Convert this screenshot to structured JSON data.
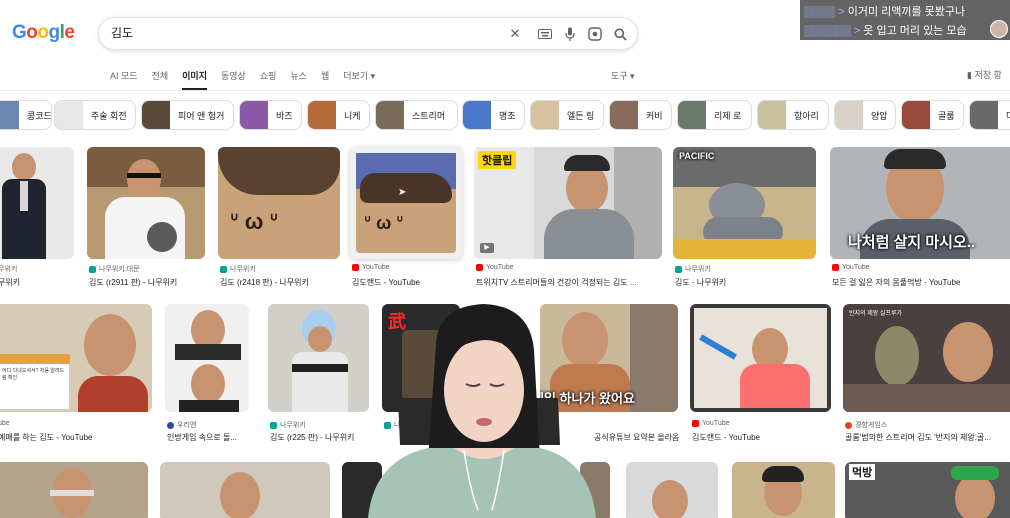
{
  "search": {
    "query": "김도"
  },
  "chat": [
    {
      "user": "",
      "message": "이거미 리액끼를 못봤구나"
    },
    {
      "user": "",
      "message": "옷 입고 머리 있는 모습"
    }
  ],
  "tabs": [
    {
      "label": "AI 모드"
    },
    {
      "label": "전체"
    },
    {
      "label": "이미지"
    },
    {
      "label": "동영상"
    },
    {
      "label": "쇼핑"
    },
    {
      "label": "뉴스"
    },
    {
      "label": "웹"
    },
    {
      "label": "더보기 ▾"
    }
  ],
  "tools_label": "도구 ▾",
  "saved_label": "저장 항",
  "chips": [
    {
      "label": "콩코드",
      "color": "#6b86b0"
    },
    {
      "label": "주술 회전",
      "color": "#e8e8e8"
    },
    {
      "label": "피어 앤 헝거",
      "color": "#5b4b3a"
    },
    {
      "label": "바즈",
      "color": "#8a5aa8"
    },
    {
      "label": "니케",
      "color": "#b66a3a"
    },
    {
      "label": "스트리머",
      "color": "#7a6a58"
    },
    {
      "label": "명조",
      "color": "#4a78c8"
    },
    {
      "label": "엘든 링",
      "color": "#d6c2a0"
    },
    {
      "label": "커비",
      "color": "#8a6a5a"
    },
    {
      "label": "리제 로",
      "color": "#6a7a6a"
    },
    {
      "label": "항아리",
      "color": "#c9c0a0"
    },
    {
      "label": "양압",
      "color": "#d9d2c8"
    },
    {
      "label": "골룸",
      "color": "#9a4a3a"
    },
    {
      "label": "더",
      "color": "#6a6a6a"
    }
  ],
  "results_row1": [
    {
      "source": "무위키",
      "caption": "무위키",
      "fav": "nw"
    },
    {
      "source": "나무위키:대문",
      "caption": "김도 (r2911 판) - 나무위키",
      "fav": "nw"
    },
    {
      "source": "나무위키",
      "caption": "김도 (r2418 판) - 나무위키",
      "fav": "nw"
    },
    {
      "source": "YouTube",
      "caption": "김도랜드 - YouTube",
      "fav": "yt"
    },
    {
      "source": "YouTube",
      "caption": "트위치TV 스트리머들의 건강이 걱정되는 김도 ...",
      "fav": "yt"
    },
    {
      "source": "나무위키",
      "caption": "김도 - 나무위키",
      "fav": "nw"
    },
    {
      "source": "YouTube",
      "caption": "모든 걸 잃은 자의 몸풀먹방 - YouTube",
      "fav": "yt"
    }
  ],
  "results_row2": [
    {
      "source": "ube",
      "caption": "예매를 하는 김도 - YouTube",
      "fav": "yt"
    },
    {
      "source": "우리엔",
      "caption": "인방게임 속으로 돌...",
      "fav": "uw"
    },
    {
      "source": "나무위키",
      "caption": "김도 (r225 판) - 나무위키",
      "fav": "nw"
    },
    {
      "source": "나무위키",
      "caption": "",
      "fav": "nw"
    },
    {
      "source": "",
      "caption": "공식유튜브 요약본 올라옴",
      "fav": "yt"
    },
    {
      "source": "YouTube",
      "caption": "김도랜드 - YouTube",
      "fav": "yt"
    },
    {
      "source": "경향게임스",
      "caption": "골룸'범의한 스트리머 김도 '반지의 제왕:골...",
      "fav": "gv"
    }
  ],
  "overlays": {
    "img_r1_7": "나처럼 살지 마시오..",
    "img_r2_5": "메일 하나가 왔어요",
    "img_r1_5_badge": "핫클립",
    "img_r3_badge": "먹방",
    "img_r2_7_banner": "반지의 제왕 실프루가",
    "img_r2_4_badge": "武",
    "img_r1_6_badge": "PACIFIC",
    "img_r2_1_dialog": "어디 다녀오셔서? 처음 알려드림 확인"
  }
}
